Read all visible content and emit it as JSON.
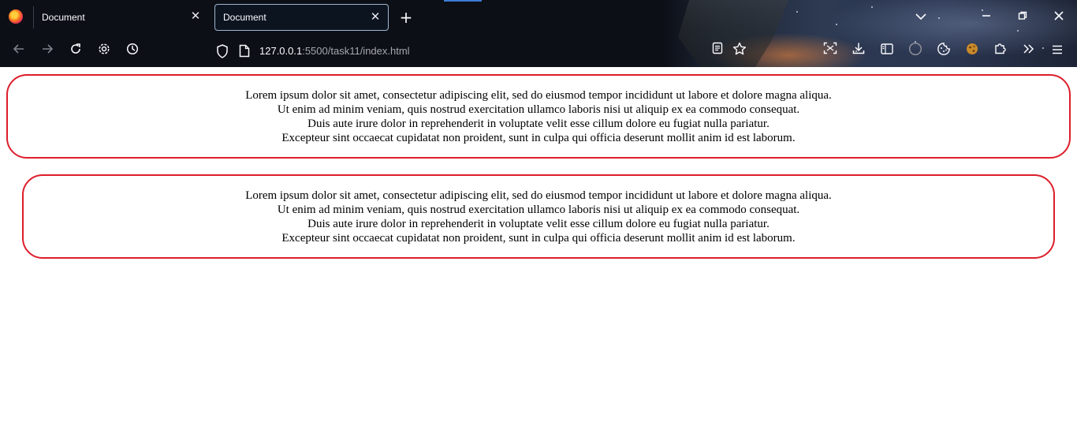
{
  "browser": {
    "tabs": [
      {
        "title": "Document",
        "active": false
      },
      {
        "title": "Document",
        "active": true
      }
    ],
    "new_tab_icon": "plus-icon",
    "window_controls": [
      "list-all-tabs-icon",
      "minimize-icon",
      "restore-icon",
      "close-icon"
    ],
    "nav_icons": [
      "back-arrow-icon",
      "forward-arrow-icon",
      "reload-icon",
      "settings-gear-icon",
      "history-clock-icon"
    ],
    "address": {
      "host": "127.0.0.1",
      "rest": ":5500/task11/index.html"
    },
    "toolbar_icons": [
      "reader-view-icon",
      "bookmark-star-icon",
      "screenshot-icon",
      "downloads-icon",
      "sidebar-icon",
      "account-circle-icon",
      "cookie-icon",
      "extension-cookie-icon",
      "extensions-puzzle-icon",
      "overflow-chevrons-icon",
      "menu-hamburger-icon"
    ],
    "accent_colors": {
      "tab_border": "#9fb7cf",
      "box_border": "#dd1e2a"
    }
  },
  "page": {
    "boxes": [
      {
        "lines": [
          "Lorem ipsum dolor sit amet, consectetur adipiscing elit, sed do eiusmod tempor incididunt ut labore et dolore magna aliqua.",
          "Ut enim ad minim veniam, quis nostrud exercitation ullamco laboris nisi ut aliquip ex ea commodo consequat.",
          "Duis aute irure dolor in reprehenderit in voluptate velit esse cillum dolore eu fugiat nulla pariatur.",
          "Excepteur sint occaecat cupidatat non proident, sunt in culpa qui officia deserunt mollit anim id est laborum."
        ]
      },
      {
        "lines": [
          "Lorem ipsum dolor sit amet, consectetur adipiscing elit, sed do eiusmod tempor incididunt ut labore et dolore magna aliqua.",
          "Ut enim ad minim veniam, quis nostrud exercitation ullamco laboris nisi ut aliquip ex ea commodo consequat.",
          "Duis aute irure dolor in reprehenderit in voluptate velit esse cillum dolore eu fugiat nulla pariatur.",
          "Excepteur sint occaecat cupidatat non proident, sunt in culpa qui officia deserunt mollit anim id est laborum."
        ]
      }
    ]
  }
}
